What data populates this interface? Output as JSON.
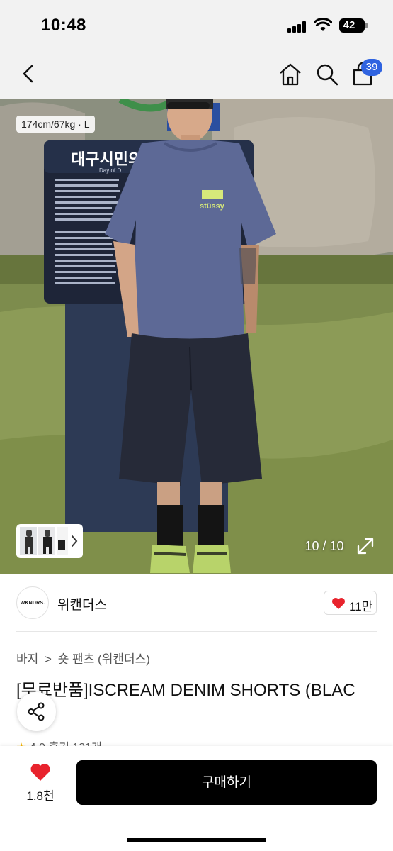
{
  "status_bar": {
    "time": "10:48",
    "battery": "42"
  },
  "nav": {
    "cart_count": "39"
  },
  "hero": {
    "size_info": "174cm/67kg · L",
    "counter": "10 / 10",
    "sign_title": "대구시민의",
    "sign_subtitle": "Day of D",
    "shirt_logo": "stüssy"
  },
  "shop": {
    "logo_text": "WKNDRS.",
    "name": "위캔더스",
    "like_count": "11만"
  },
  "breadcrumb": {
    "level1": "바지",
    "separator": ">",
    "level2": "숏 팬츠 (위캔더스)"
  },
  "product": {
    "title": "[무료반품]ISCREAM DENIM SHORTS (BLAC",
    "rating": "4.9",
    "reviews": "후기 121개"
  },
  "bottom_bar": {
    "wish_count": "1.8천",
    "buy_label": "구매하기"
  },
  "colors": {
    "accent_badge": "#2f63e0",
    "heart": "#e8232d",
    "buy_button": "#000000"
  },
  "icons": [
    "back-icon",
    "home-icon",
    "search-icon",
    "cart-icon",
    "chevron-right-icon",
    "expand-icon",
    "heart-icon",
    "share-icon",
    "star-icon"
  ]
}
